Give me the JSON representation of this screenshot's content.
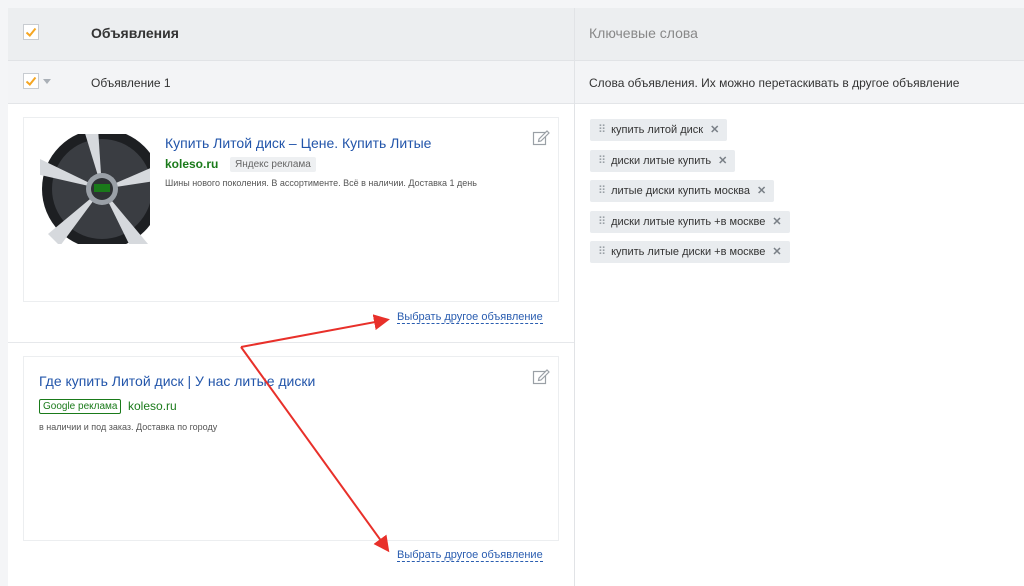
{
  "header": {
    "ads_title": "Объявления",
    "keywords_title": "Ключевые слова"
  },
  "subheader": {
    "ad_label": "Объявление 1",
    "keywords_hint": "Слова объявления. Их можно перетаскивать в другое объявление"
  },
  "ads": [
    {
      "title": "Купить Литой диск – Цене. Купить Литые",
      "domain": "koleso.ru",
      "badge": "Яндекс реклама",
      "text": "Шины нового поколения. В ассортименте. Всё в наличии. Доставка 1 день",
      "choose_link": "Выбрать другое объявление"
    },
    {
      "title": "Где купить Литой диск | У нас литые диски",
      "domain": "koleso.ru",
      "badge": "Google реклама",
      "text": "в наличии и под заказ. Доставка по городу",
      "choose_link": "Выбрать другое объявление"
    }
  ],
  "keywords": [
    "купить литой диск",
    "диски литые купить",
    "литые диски купить москва",
    "диски литые купить +в москве",
    "купить литые диски +в москве"
  ],
  "colors": {
    "checkmark": "#f5a623",
    "arrow": "#e8302a",
    "link": "#2a5db0",
    "domain": "#1a7a1a"
  }
}
